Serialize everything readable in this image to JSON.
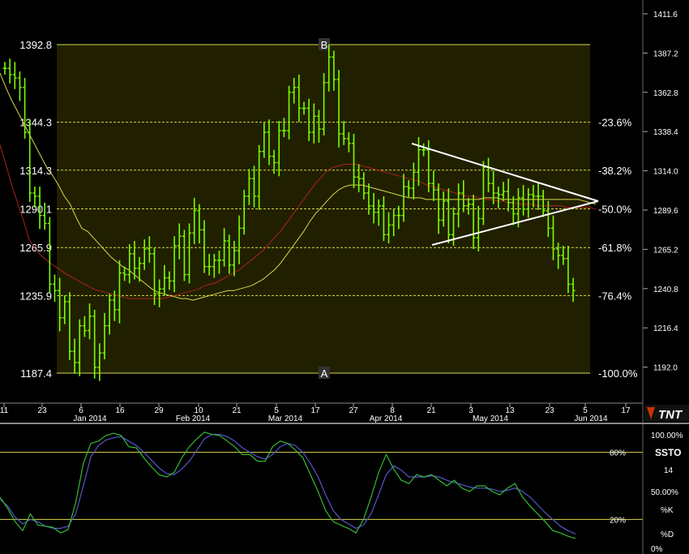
{
  "chart_data": {
    "type": "bar",
    "main": {
      "price_axis_ticks": [
        "1411.6",
        "1387.2",
        "1362.8",
        "1338.4",
        "1314.0",
        "1289.6",
        "1265.2",
        "1240.8",
        "1216.4",
        "1192.0"
      ],
      "fib_levels": [
        {
          "price": 1392.8,
          "left_label": "1392.8",
          "right_label": "",
          "marker": "B"
        },
        {
          "price": 1344.3,
          "left_label": "1344.3",
          "right_label": "-23.6%"
        },
        {
          "price": 1314.3,
          "left_label": "1314.3",
          "right_label": "-38.2%"
        },
        {
          "price": 1290.1,
          "left_label": "1290.1",
          "right_label": "-50.0%"
        },
        {
          "price": 1265.9,
          "left_label": "1265.9",
          "right_label": "-61.8%"
        },
        {
          "price": 1235.9,
          "left_label": "1235.9",
          "right_label": "-76.4%"
        },
        {
          "price": 1187.4,
          "left_label": "1187.4",
          "right_label": "-100.0%",
          "marker": "A"
        }
      ],
      "date_ticks": [
        "11",
        "23",
        "6",
        "16",
        "29",
        "10",
        "21",
        "5",
        "17",
        "27",
        "8",
        "21",
        "3",
        "13",
        "23",
        "5",
        "17"
      ],
      "month_labels": [
        "Jan 2014",
        "Feb 2014",
        "Mar 2014",
        "Apr 2014",
        "May 2014",
        "Jun 2014"
      ],
      "closes": [
        1378,
        1374,
        1372,
        1366,
        1338,
        1300,
        1298,
        1286,
        1281,
        1243,
        1239,
        1222,
        1232,
        1201,
        1194,
        1217,
        1214,
        1223,
        1191,
        1200,
        1217,
        1233,
        1227,
        1250,
        1249,
        1262,
        1253,
        1256,
        1265,
        1262,
        1237,
        1240,
        1247,
        1245,
        1267,
        1273,
        1249,
        1275,
        1289,
        1277,
        1254,
        1254,
        1258,
        1258,
        1270,
        1255,
        1264,
        1278,
        1298,
        1309,
        1298,
        1326,
        1338,
        1323,
        1319,
        1339,
        1339,
        1363,
        1366,
        1353,
        1353,
        1338,
        1348,
        1340,
        1369,
        1385,
        1371,
        1337,
        1334,
        1331,
        1310,
        1309,
        1300,
        1292,
        1288,
        1292,
        1274,
        1280,
        1286,
        1286,
        1304,
        1303,
        1313,
        1327,
        1327,
        1306,
        1302,
        1283,
        1295,
        1274,
        1287,
        1300,
        1292,
        1293,
        1272,
        1284,
        1316,
        1306,
        1300,
        1299,
        1301,
        1294,
        1287,
        1297,
        1290,
        1299,
        1298,
        1298,
        1289,
        1278,
        1265,
        1261,
        1259,
        1243,
        1239
      ],
      "ma_yellow": [
        1375,
        1366,
        1358,
        1351,
        1344,
        1337,
        1330,
        1323,
        1316,
        1311,
        1305,
        1298,
        1293,
        1285,
        1278,
        1276,
        1272,
        1268,
        1264,
        1260,
        1257,
        1254,
        1252,
        1249,
        1246,
        1243,
        1240,
        1238,
        1237,
        1236,
        1235,
        1234,
        1234,
        1233,
        1234,
        1235,
        1236,
        1237,
        1238,
        1239,
        1239,
        1240,
        1241,
        1242,
        1244,
        1246,
        1249,
        1252,
        1256,
        1261,
        1266,
        1271,
        1276,
        1282,
        1287,
        1291,
        1295,
        1299,
        1302,
        1304,
        1305,
        1305,
        1305,
        1304,
        1303,
        1302,
        1301,
        1300,
        1299,
        1298,
        1297,
        1297,
        1297,
        1296,
        1296,
        1296,
        1296,
        1296,
        1296,
        1296,
        1296,
        1296,
        1296,
        1297,
        1297,
        1297,
        1296,
        1296,
        1296,
        1296,
        1296,
        1296,
        1296,
        1296,
        1296,
        1296,
        1296,
        1296,
        1296,
        1296,
        1295,
        1294,
        1293
      ],
      "ma_red": [
        1330,
        1318,
        1305,
        1294,
        1283,
        1271,
        1265,
        1261,
        1258,
        1255,
        1253,
        1250,
        1248,
        1246,
        1244,
        1242,
        1240,
        1239,
        1238,
        1237,
        1236,
        1235,
        1234,
        1234,
        1234,
        1234,
        1234,
        1234,
        1234,
        1235,
        1236,
        1237,
        1238,
        1239,
        1240,
        1242,
        1243,
        1244,
        1246,
        1248,
        1250,
        1252,
        1255,
        1258,
        1261,
        1264,
        1268,
        1272,
        1276,
        1281,
        1286,
        1291,
        1296,
        1301,
        1306,
        1310,
        1314,
        1316,
        1317,
        1318,
        1318,
        1318,
        1317,
        1316,
        1315,
        1314,
        1313,
        1312,
        1311,
        1310,
        1309,
        1308,
        1307,
        1305,
        1304,
        1303,
        1302,
        1301,
        1300,
        1299,
        1298,
        1298,
        1297,
        1296,
        1296,
        1295,
        1295,
        1294,
        1294,
        1293,
        1293,
        1293,
        1292,
        1292,
        1292,
        1292,
        1292,
        1291,
        1291,
        1291,
        1291,
        1291,
        1290
      ]
    },
    "indicator": {
      "name": "SSTO",
      "period": "14",
      "k_label": "%K",
      "d_label": "%D",
      "right_ticks": [
        "100.00%",
        "50.00%",
        "0%"
      ],
      "level_labels": [
        "80%",
        "20%"
      ],
      "k": [
        40,
        30,
        18,
        10,
        25,
        15,
        14,
        13,
        8,
        11,
        35,
        70,
        88,
        90,
        95,
        97,
        95,
        85,
        84,
        75,
        67,
        60,
        58,
        62,
        75,
        85,
        92,
        98,
        96,
        95,
        90,
        85,
        78,
        78,
        72,
        72,
        85,
        90,
        88,
        82,
        75,
        60,
        45,
        28,
        18,
        15,
        12,
        8,
        20,
        40,
        62,
        78,
        65,
        55,
        52,
        60,
        58,
        60,
        55,
        50,
        55,
        48,
        45,
        50,
        50,
        45,
        42,
        48,
        52,
        40,
        32,
        25,
        18,
        10,
        8,
        5,
        3
      ],
      "d": [
        38,
        32,
        22,
        16,
        20,
        18,
        14,
        12,
        12,
        14,
        25,
        50,
        76,
        86,
        91,
        93,
        94,
        90,
        86,
        80,
        73,
        66,
        61,
        60,
        65,
        72,
        82,
        92,
        96,
        96,
        94,
        90,
        84,
        80,
        76,
        74,
        78,
        85,
        88,
        86,
        80,
        70,
        58,
        42,
        28,
        20,
        16,
        12,
        15,
        25,
        42,
        60,
        68,
        64,
        58,
        58,
        58,
        59,
        58,
        55,
        53,
        51,
        49,
        48,
        48,
        47,
        45,
        46,
        48,
        45,
        40,
        33,
        26,
        20,
        14,
        10,
        7
      ]
    }
  },
  "branding": {
    "logo_text": "TNT"
  }
}
